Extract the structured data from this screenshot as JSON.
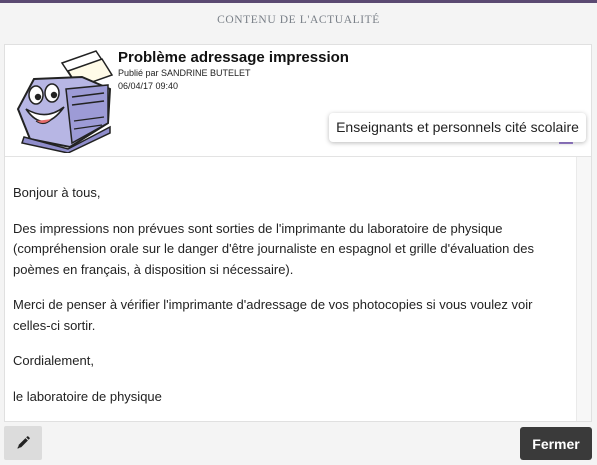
{
  "dialog": {
    "title": "CONTENU DE L'ACTUALITÉ"
  },
  "post": {
    "title": "Problème adressage impression",
    "published_by": "Publié par SANDRINE BUTELET",
    "datetime": "06/04/17 09:40",
    "thumbnail_icon": "printer-cartoon-icon",
    "audience_icon": "users-group-icon",
    "audience_tooltip": "Enseignants et personnels cité scolaire",
    "body": [
      "Bonjour à tous,",
      "Des impressions non prévues sont sorties de l'imprimante du laboratoire de physique (compréhension orale sur le danger d'être journaliste en espagnol et grille d'évaluation des poèmes en français, à disposition si  nécessaire).",
      "Merci de penser à vérifier l'imprimante d'adressage de vos photocopies si vous voulez voir celles-ci sortir.",
      "Cordialement,",
      "le laboratoire de physique"
    ]
  },
  "footer": {
    "edit_icon": "pencil-icon",
    "close_label": "Fermer"
  },
  "colors": {
    "header_strip": "#5b4a72",
    "audience_icon": "#a78bd6",
    "close_button": "#3a3a3a"
  }
}
